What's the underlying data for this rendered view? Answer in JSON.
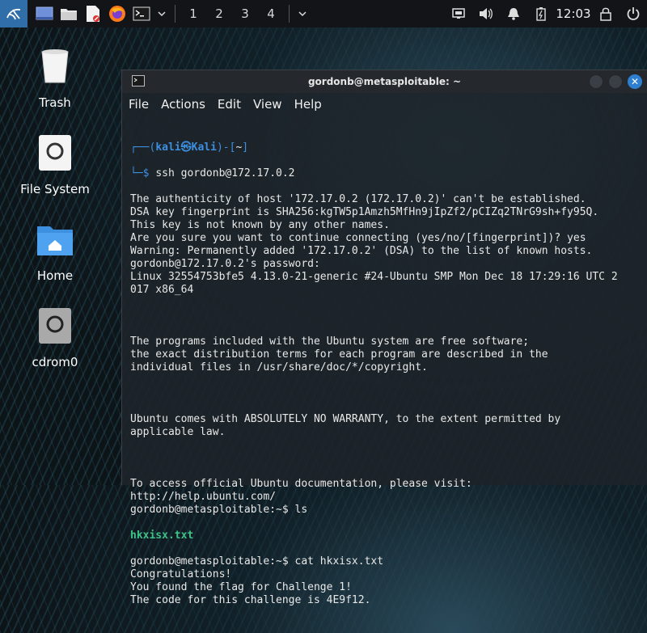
{
  "panel": {
    "workspaces": [
      "1",
      "2",
      "3",
      "4"
    ],
    "clock": "12:03"
  },
  "desktop": {
    "icons": [
      {
        "label": "Trash"
      },
      {
        "label": "File System"
      },
      {
        "label": "Home"
      },
      {
        "label": "cdrom0"
      }
    ]
  },
  "window": {
    "title": "gordonb@metasploitable: ~",
    "menu": [
      "File",
      "Actions",
      "Edit",
      "View",
      "Help"
    ]
  },
  "terminal": {
    "prompt_user": "kali",
    "prompt_host": "Kali",
    "prompt_dir": "~",
    "command": "ssh gordonb@172.17.0.2",
    "lines_a": [
      "The authenticity of host '172.17.0.2 (172.17.0.2)' can't be established.",
      "DSA key fingerprint is SHA256:kgTW5p1Amzh5MfHn9jIpZf2/pCIZq2TNrG9sh+fy95Q.",
      "This key is not known by any other names.",
      "Are you sure you want to continue connecting (yes/no/[fingerprint])? yes",
      "Warning: Permanently added '172.17.0.2' (DSA) to the list of known hosts.",
      "gordonb@172.17.0.2's password:",
      "Linux 32554753bfe5 4.13.0-21-generic #24-Ubuntu SMP Mon Dec 18 17:29:16 UTC 2",
      "017 x86_64"
    ],
    "lines_b": [
      "The programs included with the Ubuntu system are free software;",
      "the exact distribution terms for each program are described in the",
      "individual files in /usr/share/doc/*/copyright."
    ],
    "lines_c": [
      "Ubuntu comes with ABSOLUTELY NO WARRANTY, to the extent permitted by",
      "applicable law."
    ],
    "lines_d": [
      "To access official Ubuntu documentation, please visit:",
      "http://help.ubuntu.com/",
      "gordonb@metasploitable:~$ ls"
    ],
    "ls_output": "hkxisx.txt",
    "lines_e": [
      "gordonb@metasploitable:~$ cat hkxisx.txt",
      "Congratulations!",
      "You found the flag for Challenge 1!",
      "The code for this challenge is 4E9f12."
    ]
  }
}
